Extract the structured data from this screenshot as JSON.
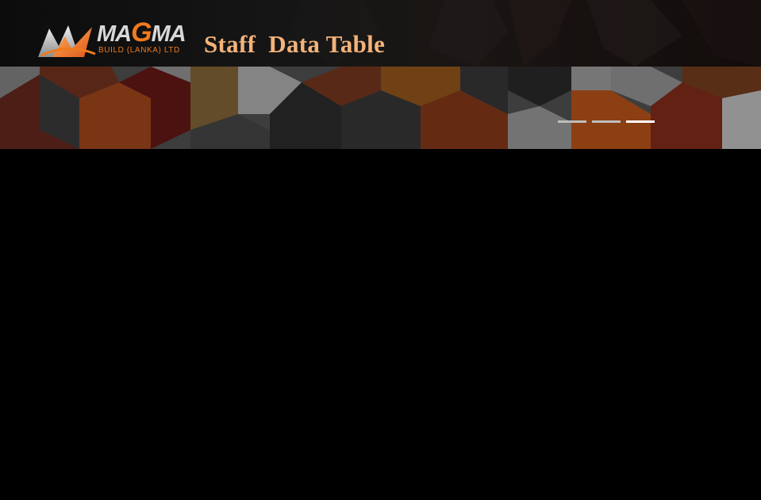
{
  "brand": {
    "logo_name": "MAGMA",
    "logo_subtitle": "BUILD (LANKA) LTD",
    "accent_color": "#f07a1e"
  },
  "page": {
    "title": "Staff  Data Table",
    "title_color": "#f3b37a",
    "background_color": "#000000"
  },
  "slider": {
    "slide_count": 3,
    "active_slide": 3
  }
}
